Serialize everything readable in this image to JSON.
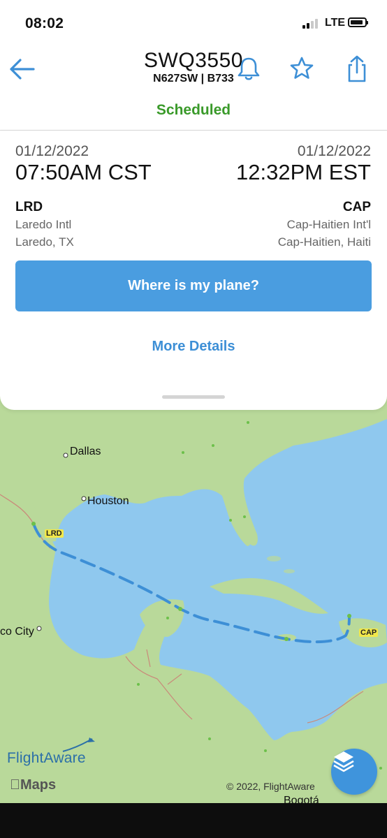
{
  "status_bar": {
    "time": "08:02",
    "network": "LTE"
  },
  "header": {
    "flight_number": "SWQ3550",
    "registration_type": "N627SW | B733",
    "status": "Scheduled",
    "icons": [
      "back-arrow-icon",
      "bell-icon",
      "star-icon",
      "share-icon"
    ],
    "accent_color": "#3d8fd6",
    "status_color": "#3a9a2a"
  },
  "departure": {
    "date": "01/12/2022",
    "time": "07:50AM CST",
    "code": "LRD",
    "airport": "Laredo Intl",
    "city": "Laredo, TX"
  },
  "arrival": {
    "date": "01/12/2022",
    "time": "12:32PM EST",
    "code": "CAP",
    "airport": "Cap-Haitien Int'l",
    "city": "Cap-Haitien, Haiti"
  },
  "actions": {
    "where_label": "Where is my plane?",
    "more_label": "More Details"
  },
  "map": {
    "cities": [
      "Dallas",
      "Houston",
      "co City"
    ],
    "origin_tag": "LRD",
    "dest_tag": "CAP",
    "brand": "FlightAware",
    "maps_label": "Maps",
    "copyright": "© 2022, FlightAware",
    "bogota": "Bogotá"
  }
}
